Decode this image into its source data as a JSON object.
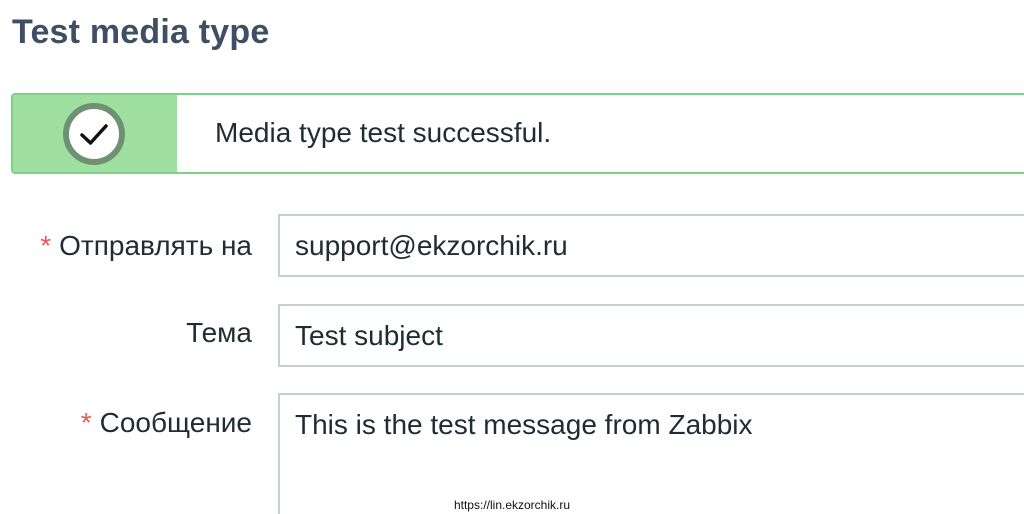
{
  "dialog": {
    "title": "Test media type"
  },
  "message": {
    "text": "Media type test successful.",
    "status": "success",
    "icon": "check-circle-icon",
    "colors": {
      "border": "#7fd087",
      "icon_bg": "#9fdf9f"
    }
  },
  "form": {
    "send_to": {
      "required_mark": "*",
      "label": "Отправлять на",
      "value": "support@ekzorchik.ru"
    },
    "subject": {
      "label": "Тема",
      "value": "Test subject"
    },
    "message_field": {
      "required_mark": "*",
      "label": "Сообщение",
      "value": "This is the test message from Zabbix"
    }
  },
  "footer": {
    "watermark": "https://lin.ekzorchik.ru"
  }
}
